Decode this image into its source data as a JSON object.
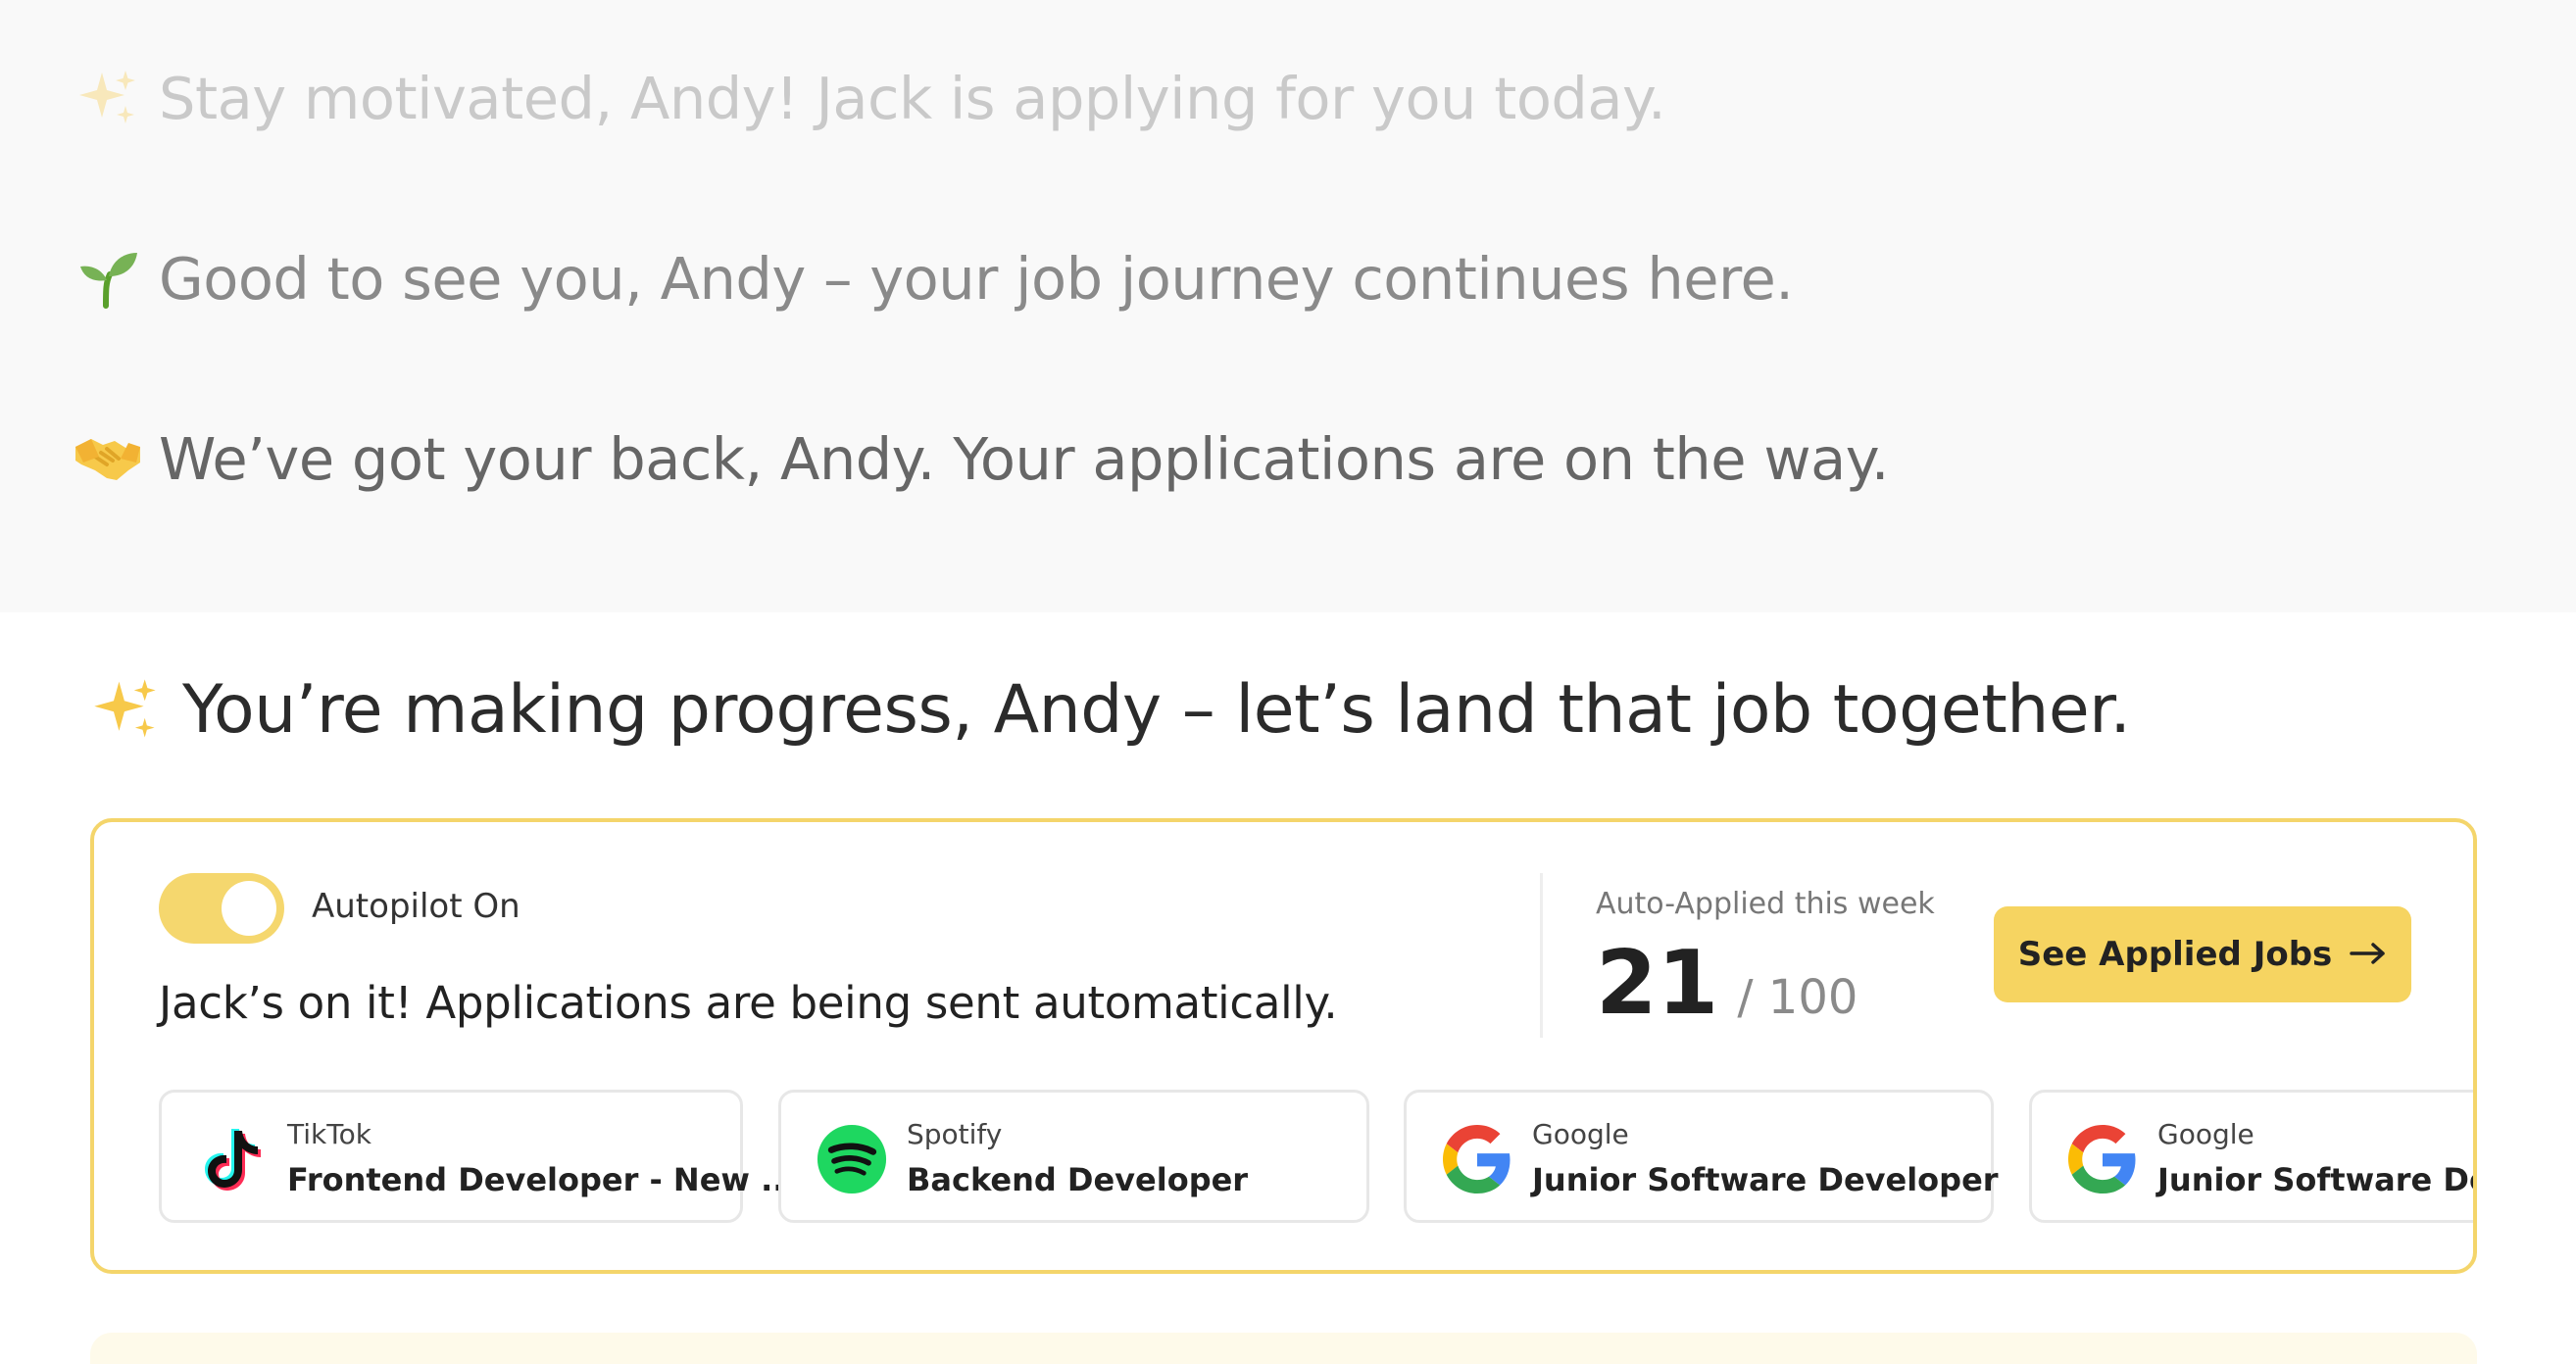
{
  "messages": [
    {
      "emoji": "sparkles-icon",
      "text": "Stay motivated, Andy! Jack is applying for you today."
    },
    {
      "emoji": "seedling-icon",
      "text": "Good to see you, Andy – your job journey continues here."
    },
    {
      "emoji": "handshake-icon",
      "text": "We’ve got your back, Andy. Your applications are on the way."
    }
  ],
  "headline": {
    "emoji": "sparkles-icon",
    "text": "You’re making progress, Andy – let’s land that job together."
  },
  "autopilot": {
    "label": "Autopilot On",
    "enabled": true,
    "status": "Jack’s on it! Applications are being sent automatically."
  },
  "stats": {
    "label": "Auto-Applied this week",
    "count": "21",
    "total": "/ 100"
  },
  "see_jobs_button": {
    "label": "See Applied Jobs",
    "icon": "arrow-right-icon"
  },
  "jobs": [
    {
      "company": "TikTok",
      "role": "Frontend Developer - New ...",
      "logo": "tiktok-logo"
    },
    {
      "company": "Spotify",
      "role": "Backend Developer",
      "logo": "spotify-logo"
    },
    {
      "company": "Google",
      "role": "Junior Software Developer",
      "logo": "google-logo"
    },
    {
      "company": "Google",
      "role": "Junior Software Developer",
      "logo": "google-logo"
    }
  ],
  "colors": {
    "accent": "#f6d461",
    "card_border": "#f4d56b",
    "spotify": "#1ed760"
  }
}
